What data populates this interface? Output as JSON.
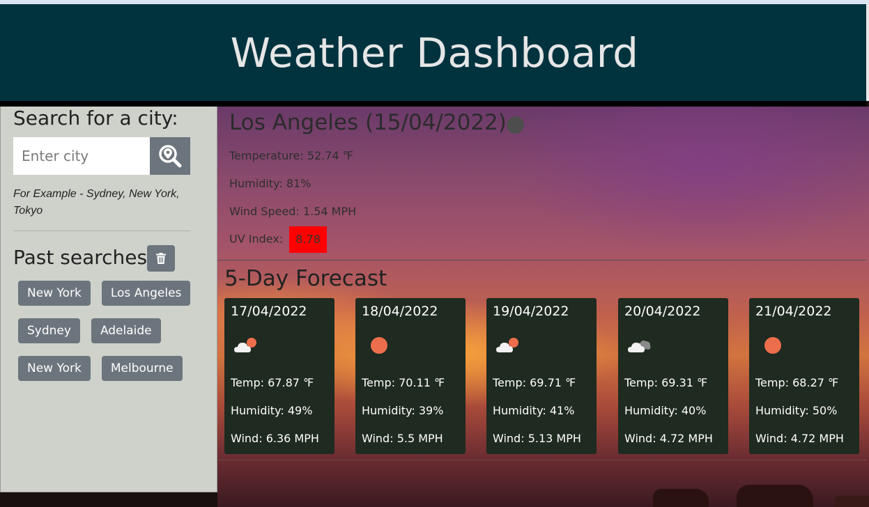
{
  "header": {
    "title": "Weather Dashboard"
  },
  "sidebar": {
    "title": "Search for a city:",
    "search_placeholder": "Enter city",
    "example": "For Example - Sydney, New York, Tokyo",
    "past_title": "Past searches",
    "history": [
      [
        "New York",
        "Los Angeles"
      ],
      [
        "Sydney",
        "Adelaide"
      ],
      [
        "New York",
        "Melbourne"
      ]
    ]
  },
  "current": {
    "city_date": "Los Angeles (15/04/2022)",
    "temperature": "Temperature: 52.74 ℉",
    "humidity": "Humidity: 81%",
    "wind": "Wind Speed: 1.54 MPH",
    "uv_label": "UV Index:",
    "uv_value": "8.78",
    "uv_color": "#ff0000"
  },
  "forecast": {
    "title": "5-Day Forecast",
    "days": [
      {
        "date": "17/04/2022",
        "icon": "cloud-sun-icon",
        "temp": "Temp: 67.87 ℉",
        "humidity": "Humidity: 49%",
        "wind": "Wind: 6.36 MPH"
      },
      {
        "date": "18/04/2022",
        "icon": "sun-icon",
        "temp": "Temp: 70.11 ℉",
        "humidity": "Humidity: 39%",
        "wind": "Wind: 5.5 MPH"
      },
      {
        "date": "19/04/2022",
        "icon": "cloud-sun-icon",
        "temp": "Temp: 69.71 ℉",
        "humidity": "Humidity: 41%",
        "wind": "Wind: 5.13 MPH"
      },
      {
        "date": "20/04/2022",
        "icon": "clouds-icon",
        "temp": "Temp: 69.31 ℉",
        "humidity": "Humidity: 40%",
        "wind": "Wind: 4.72 MPH"
      },
      {
        "date": "21/04/2022",
        "icon": "sun-icon",
        "temp": "Temp: 68.27 ℉",
        "humidity": "Humidity: 50%",
        "wind": "Wind: 4.72 MPH"
      }
    ]
  },
  "colors": {
    "header_bg": "#01333f",
    "card_bg": "#1f2a20",
    "button_bg": "#6c757d",
    "sun": "#ec6e4c"
  }
}
